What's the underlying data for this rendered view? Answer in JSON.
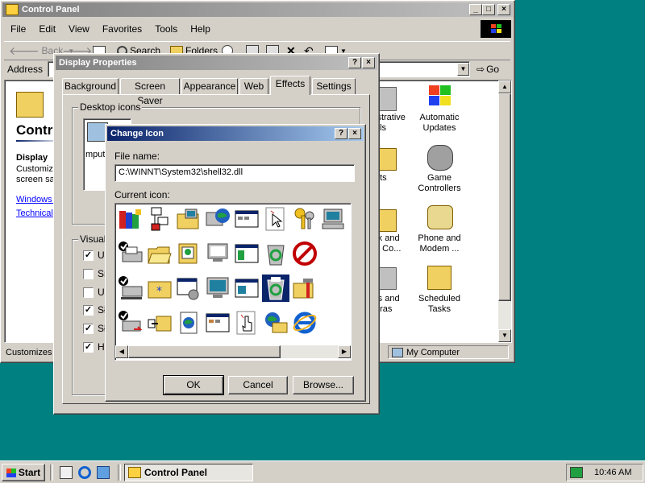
{
  "control_panel": {
    "title": "Control Panel",
    "menu": [
      "File",
      "Edit",
      "View",
      "Favorites",
      "Tools",
      "Help"
    ],
    "toolbar": {
      "back": "Back",
      "search": "Search",
      "folders": "Folders"
    },
    "address_label": "Address",
    "go_label": "Go",
    "side": {
      "heading": "Contro",
      "item_title": "Display",
      "item_desc_1": "Customize",
      "item_desc_2": "screen sav",
      "link_1": "Windows U",
      "link_2": "Technical"
    },
    "icons": [
      {
        "label": "Administrative Tools",
        "label_line1": "istrative",
        "label_line2": "ols"
      },
      {
        "label": "Automatic Updates",
        "label_line1": "Automatic",
        "label_line2": "Updates"
      },
      {
        "label_line1": "nts"
      },
      {
        "label": "Game Controllers",
        "label_line1": "Game",
        "label_line2": "Controllers"
      },
      {
        "label_line1": "rk and",
        "label_line2": "n Co..."
      },
      {
        "label": "Phone and Modem ...",
        "label_line1": "Phone and",
        "label_line2": "Modem ..."
      },
      {
        "label_line1": "rs and",
        "label_line2": "eras"
      },
      {
        "label": "Scheduled Tasks",
        "label_line1": "Scheduled",
        "label_line2": "Tasks"
      }
    ],
    "status_left": "Customizes y",
    "status_right": "My Computer"
  },
  "display_properties": {
    "title": "Display Properties",
    "tabs": [
      "Background",
      "Screen Saver",
      "Appearance",
      "Web",
      "Effects",
      "Settings"
    ],
    "selected_tab": "Effects",
    "desktop_icons_label": "Desktop icons",
    "desktop_icon_caption": "mpute",
    "visual_label": "Visual",
    "visual_checks": [
      {
        "text": "U",
        "checked": true
      },
      {
        "text": "Sr",
        "checked": false
      },
      {
        "text": "U",
        "checked": false
      },
      {
        "text": "Sł",
        "checked": true
      },
      {
        "text": "Sł",
        "checked": true
      },
      {
        "text": "H",
        "checked": true
      }
    ]
  },
  "change_icon": {
    "title": "Change Icon",
    "file_name_label": "File name:",
    "file_name_value": "C:\\WINNT\\System32\\shell32.dll",
    "current_icon_label": "Current icon:",
    "ok": "OK",
    "cancel": "Cancel",
    "browse": "Browse..."
  },
  "taskbar": {
    "start": "Start",
    "task": "Control Panel",
    "clock": "10:46 AM"
  }
}
